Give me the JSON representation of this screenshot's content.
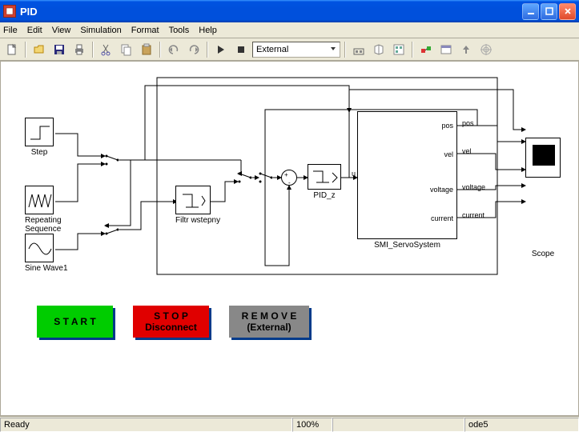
{
  "window": {
    "title": "PID",
    "buttons": {
      "min": "_",
      "max": "□",
      "close": "×"
    }
  },
  "menu": {
    "items": [
      "File",
      "Edit",
      "View",
      "Simulation",
      "Format",
      "Tools",
      "Help"
    ]
  },
  "toolbar": {
    "mode_value": "External",
    "icons": {
      "new": "new-icon",
      "open": "open-icon",
      "save": "save-icon",
      "print": "print-icon",
      "cut": "cut-icon",
      "copy": "copy-icon",
      "paste": "paste-icon",
      "undo": "undo-icon",
      "redo": "redo-icon",
      "play": "play-icon",
      "stop": "stop-icon",
      "build": "build-icon",
      "library": "library-icon",
      "model_explorer": "model-explorer-icon",
      "debug": "debug-icon",
      "update": "update-icon",
      "up": "up-icon",
      "target": "target-icon"
    }
  },
  "sources": {
    "step": "Step",
    "repeating": "Repeating\nSequence",
    "sine": "Sine Wave1"
  },
  "blocks": {
    "filter": "Filtr wstepny",
    "pid": "PID_z",
    "plant": "SMI_ServoSystem",
    "scope": "Scope",
    "u": "u"
  },
  "ports": {
    "pos": "pos",
    "vel": "vel",
    "voltage": "voltage",
    "current": "current"
  },
  "buttons": {
    "start": {
      "line1": "S T A R T"
    },
    "stop": {
      "line1": "S T O P",
      "line2": "Disconnect"
    },
    "remove": {
      "line1": "R E M O V E",
      "line2": "(External)"
    }
  },
  "status": {
    "ready": "Ready",
    "zoom": "100%",
    "solver": "ode5"
  }
}
